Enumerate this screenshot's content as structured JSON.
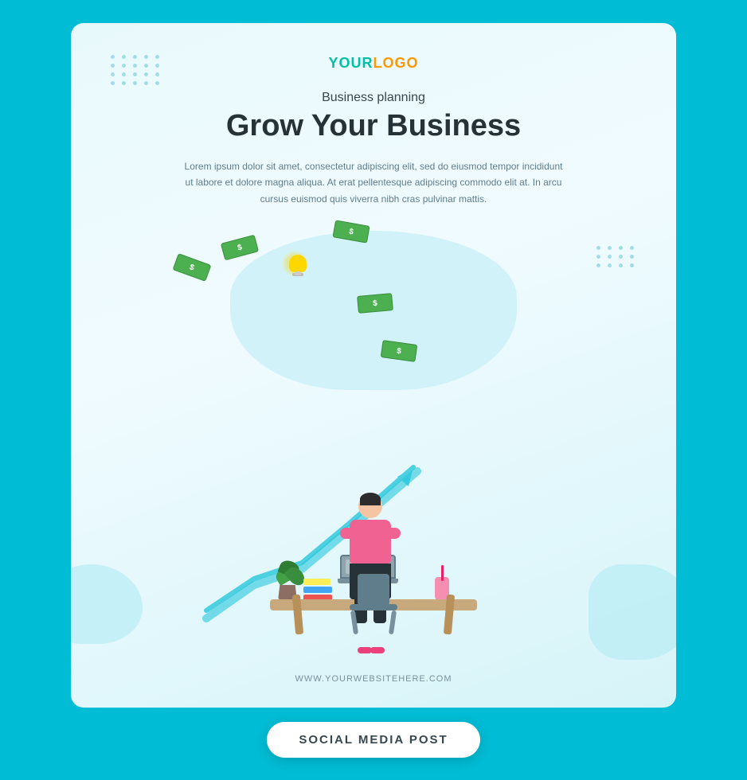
{
  "background_color": "#00bcd4",
  "card": {
    "logo": {
      "your": "YOUR",
      "logo": "LOGO"
    },
    "subtitle": "Business planning",
    "main_title": "Grow Your Business",
    "description": "Lorem ipsum dolor sit amet, consectetur adipiscing elit, sed do eiusmod tempor incididunt ut labore et dolore magna aliqua. At erat pellentesque adipiscing commodo elit at. In arcu cursus euismod quis viverra nibh cras pulvinar mattis.",
    "website_url": "WWW.YOURWEBSITEHERE.COM"
  },
  "button": {
    "label": "SOCIAL MEDIA POST"
  },
  "dots": {
    "topleft_count": 20,
    "right_count": 12
  }
}
